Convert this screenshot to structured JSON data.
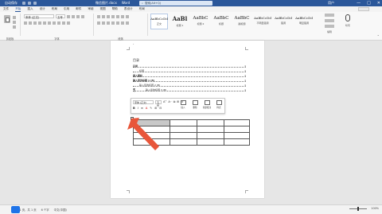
{
  "window": {
    "autosave_label": "自动保存",
    "doc_title": "微信图片.docx",
    "app_name": "Word",
    "search_placeholder": "搜索(Alt+Q)",
    "user": "用户",
    "controls": [
      "—",
      "□",
      "✕"
    ]
  },
  "menu": {
    "tabs": [
      "文件",
      "开始",
      "插入",
      "设计",
      "布局",
      "引用",
      "邮件",
      "审阅",
      "视图",
      "帮助",
      "表设计",
      "布局"
    ],
    "active_index": 1
  },
  "ribbon": {
    "font_name": "宋体 (正文)",
    "font_size": "五号",
    "group_labels": [
      "剪贴板",
      "字体",
      "段落",
      "样式",
      "编辑",
      "语音"
    ],
    "styles": [
      {
        "sample": "AaBbCcDd",
        "name": "正文",
        "kind": "small"
      },
      {
        "sample": "AaBl",
        "name": "标题 1",
        "kind": "big"
      },
      {
        "sample": "AaBbC",
        "name": "标题 2",
        "kind": "normal"
      },
      {
        "sample": "AaBbC",
        "name": "标题",
        "kind": "normal"
      },
      {
        "sample": "AaBbC",
        "name": "副标题",
        "kind": "normal"
      },
      {
        "sample": "AaBbCcDd",
        "name": "不明显强调",
        "kind": "small"
      },
      {
        "sample": "AaBbCcDd",
        "name": "强调",
        "kind": "small"
      },
      {
        "sample": "AaBbCcDd",
        "name": "明显强调",
        "kind": "small"
      }
    ],
    "edit_label": "编辑",
    "voice_label": "听写"
  },
  "document": {
    "toc_title": "目录",
    "toc_lines": [
      {
        "text": "目录",
        "page": "1",
        "level": "b"
      },
      {
        "text": "标题",
        "page": "1",
        "level": "i1"
      },
      {
        "text": "插入图标",
        "page": "1",
        "level": "b"
      },
      {
        "text": "输入您的标题 1 (B)",
        "page": "1",
        "level": "b"
      },
      {
        "text": "输入您的标题 2 (B)",
        "page": "1",
        "level": "i1"
      },
      {
        "text": "输入您的标题 3 (B)",
        "page": "1",
        "level": "i2"
      }
    ],
    "mini_toolbar": {
      "font_name": "宋体 (正文)",
      "font_size": "五号",
      "row1": [
        "A⁺",
        "A⁻",
        "⧉",
        "⊞",
        "⊟"
      ],
      "row2": [
        "B",
        "I",
        "≡",
        "A",
        "✎",
        "⊞",
        "⊟"
      ],
      "buttons": [
        "插入",
        "删除",
        "新建批注",
        "样式"
      ]
    },
    "table_rows": [
      [
        "",
        "",
        "",
        ""
      ],
      [
        "",
        "",
        "",
        ""
      ],
      [
        "",
        "",
        "",
        ""
      ],
      [
        "",
        "",
        "",
        ""
      ]
    ],
    "selected_cell": [
      0,
      0
    ]
  },
  "statusbar": {
    "page": "第 1 页，共 1 页",
    "words": "6 个字",
    "language": "中文(中国)",
    "zoom": "100%",
    "taskbar_colors": [
      "#1e73e8",
      "#ffb900",
      "#e8412c",
      "#2b579a",
      "#19a053",
      "#c239b3",
      "#1490df",
      "#e8412c",
      "#555555",
      "#2b579a",
      "#0f7b0f",
      "#ff8c00",
      "#3a3a3a",
      "#1e73e8",
      "#c43e1c"
    ]
  }
}
